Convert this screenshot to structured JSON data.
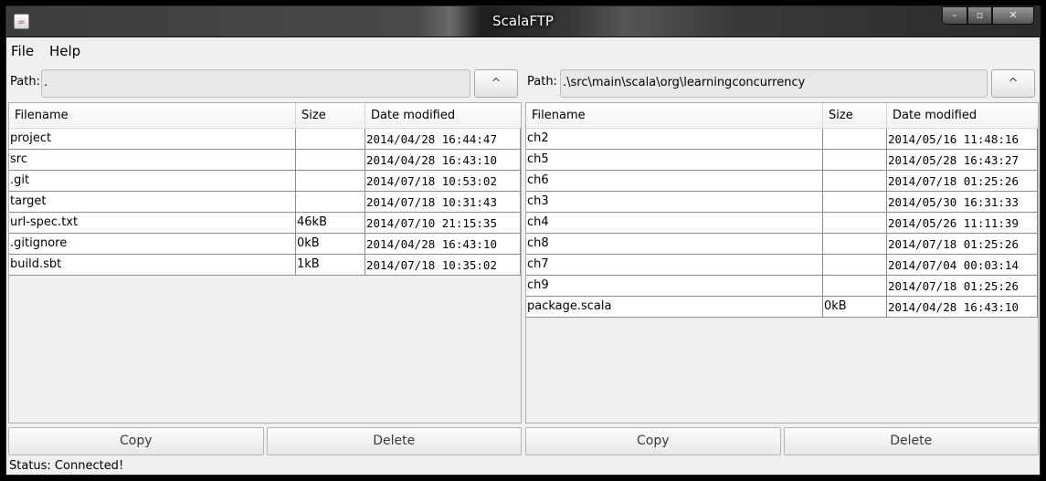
{
  "window": {
    "title": "ScalaFTP",
    "controls": {
      "minimize": "–",
      "maximize": "▫",
      "close": "✕"
    }
  },
  "menu": [
    "File",
    "Help"
  ],
  "left": {
    "path_label": "Path:",
    "path_value": ".",
    "up_label": "^",
    "columns": [
      "Filename",
      "Size",
      "Date modified"
    ],
    "rows": [
      [
        "project",
        "",
        "2014/04/28 16:44:47"
      ],
      [
        "src",
        "",
        "2014/04/28 16:43:10"
      ],
      [
        ".git",
        "",
        "2014/07/18 10:53:02"
      ],
      [
        "target",
        "",
        "2014/07/18 10:31:43"
      ],
      [
        "url-spec.txt",
        "46kB",
        "2014/07/10 21:15:35"
      ],
      [
        ".gitignore",
        "0kB",
        "2014/04/28 16:43:10"
      ],
      [
        "build.sbt",
        "1kB",
        "2014/07/18 10:35:02"
      ]
    ],
    "copy_label": "Copy",
    "delete_label": "Delete"
  },
  "right": {
    "path_label": "Path:",
    "path_value": ".\\src\\main\\scala\\org\\learningconcurrency",
    "up_label": "^",
    "columns": [
      "Filename",
      "Size",
      "Date modified"
    ],
    "rows": [
      [
        "ch2",
        "",
        "2014/05/16 11:48:16"
      ],
      [
        "ch5",
        "",
        "2014/05/28 16:43:27"
      ],
      [
        "ch6",
        "",
        "2014/07/18 01:25:26"
      ],
      [
        "ch3",
        "",
        "2014/05/30 16:31:33"
      ],
      [
        "ch4",
        "",
        "2014/05/26 11:11:39"
      ],
      [
        "ch8",
        "",
        "2014/07/18 01:25:26"
      ],
      [
        "ch7",
        "",
        "2014/07/04 00:03:14"
      ],
      [
        "ch9",
        "",
        "2014/07/18 01:25:26"
      ],
      [
        "package.scala",
        "0kB",
        "2014/04/28 16:43:10"
      ]
    ],
    "copy_label": "Copy",
    "delete_label": "Delete"
  },
  "status": "Status: Connected!"
}
